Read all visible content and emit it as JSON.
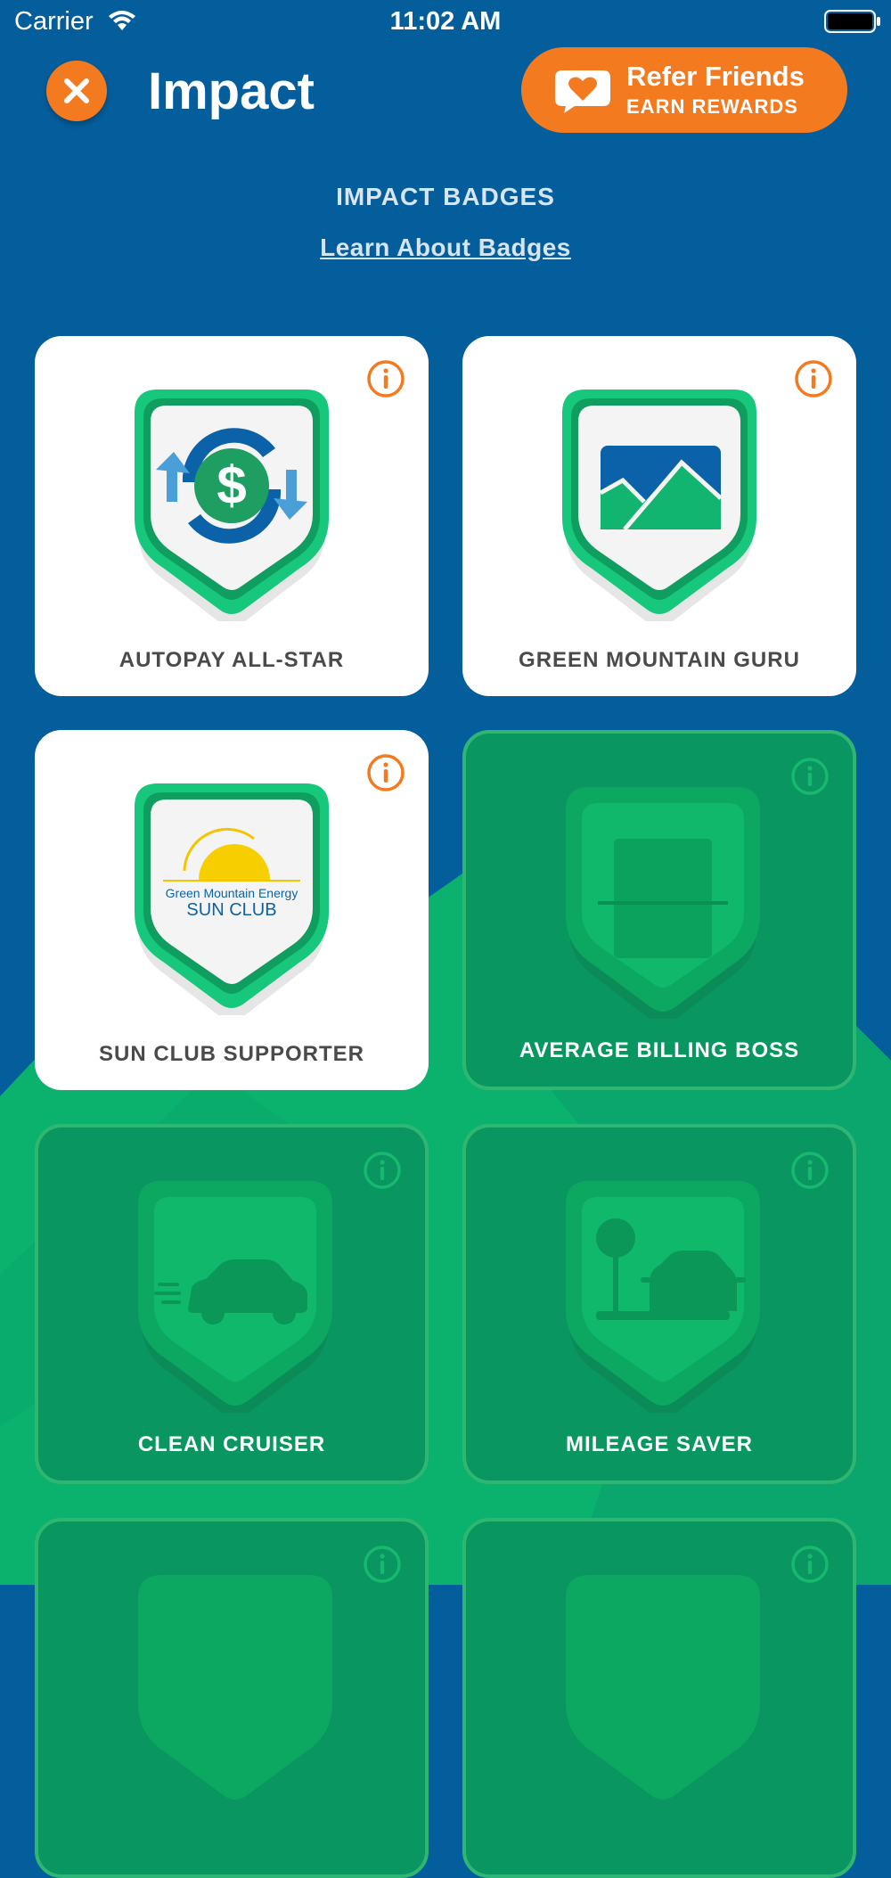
{
  "status_bar": {
    "carrier": "Carrier",
    "time": "11:02 AM"
  },
  "header": {
    "title": "Impact",
    "refer_button": {
      "line1": "Refer Friends",
      "line2": "EARN REWARDS"
    }
  },
  "section": {
    "title": "IMPACT BADGES",
    "link": "Learn About Badges"
  },
  "colors": {
    "accent": "#f47a20",
    "background_blue": "#045e9c",
    "mountain_green": "#0bb26d",
    "badge_green": "#16c77c",
    "locked_card": "#0a9660"
  },
  "badges": [
    {
      "label": "AUTOPAY ALL-STAR",
      "earned": true,
      "icon": "autopay-dollar-icon"
    },
    {
      "label": "GREEN MOUNTAIN GURU",
      "earned": true,
      "icon": "mountain-image-icon"
    },
    {
      "label": "SUN CLUB SUPPORTER",
      "earned": true,
      "icon": "sun-club-logo",
      "logo_text": {
        "line1": "Green Mountain Energy",
        "line2": "SUN CLUB"
      }
    },
    {
      "label": "AVERAGE BILLING BOSS",
      "earned": false,
      "icon": "billing-document-icon"
    },
    {
      "label": "CLEAN CRUISER",
      "earned": false,
      "icon": "electric-car-icon"
    },
    {
      "label": "MILEAGE SAVER",
      "earned": false,
      "icon": "car-parking-icon"
    },
    {
      "label": "",
      "earned": false,
      "icon": "locked-badge-icon"
    },
    {
      "label": "",
      "earned": false,
      "icon": "locked-badge-icon"
    }
  ]
}
